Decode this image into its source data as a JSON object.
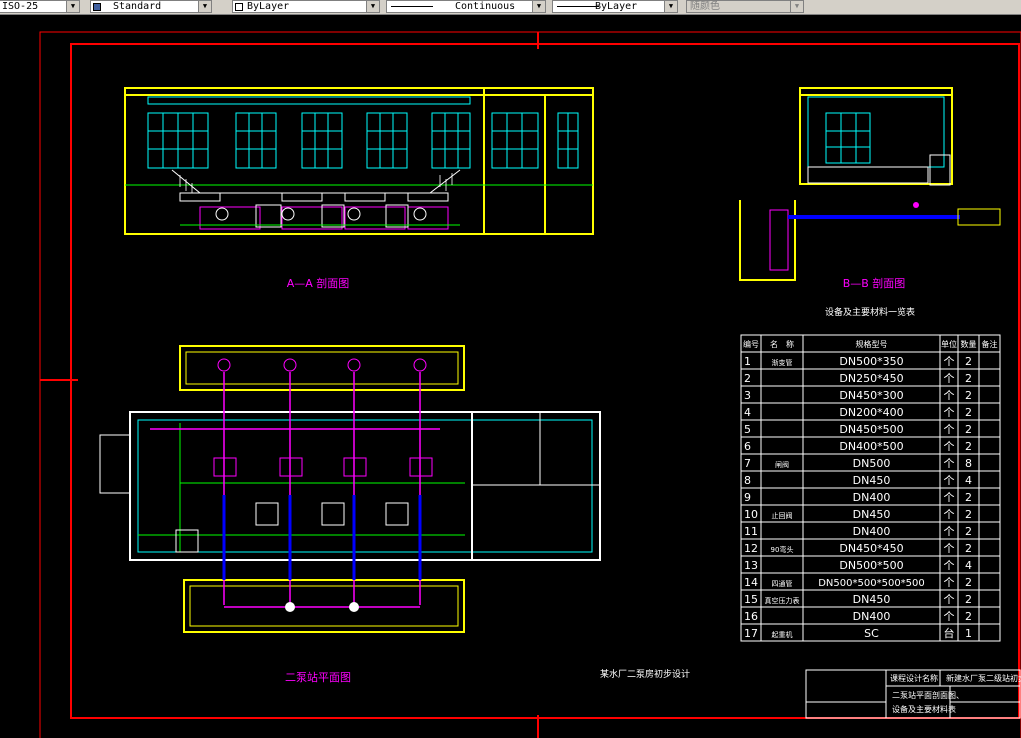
{
  "toolbar": {
    "dimstyle": "ISO-25",
    "textstyle": "Standard",
    "layer": "ByLayer",
    "linetype": "Continuous",
    "lineweight": "ByLayer",
    "plotstyle": "随颜色"
  },
  "drawing": {
    "section_a_title": "A—A 剖面图",
    "section_b_title": "B—B 剖面图",
    "plan_title": "二泵站平面图",
    "table_title": "设备及主要材料一览表",
    "table_headers": [
      "编号",
      "名　称",
      "规格型号",
      "单位",
      "数量",
      "备注"
    ],
    "table_rows": [
      [
        "1",
        "渐变管",
        "DN500*350",
        "个",
        "2",
        ""
      ],
      [
        "2",
        "",
        "DN250*450",
        "个",
        "2",
        ""
      ],
      [
        "3",
        "",
        "DN450*300",
        "个",
        "2",
        ""
      ],
      [
        "4",
        "",
        "DN200*400",
        "个",
        "2",
        ""
      ],
      [
        "5",
        "",
        "DN450*500",
        "个",
        "2",
        ""
      ],
      [
        "6",
        "",
        "DN400*500",
        "个",
        "2",
        ""
      ],
      [
        "7",
        "闸阀",
        "DN500",
        "个",
        "8",
        ""
      ],
      [
        "8",
        "",
        "DN450",
        "个",
        "4",
        ""
      ],
      [
        "9",
        "",
        "DN400",
        "个",
        "2",
        ""
      ],
      [
        "10",
        "止回阀",
        "DN450",
        "个",
        "2",
        ""
      ],
      [
        "11",
        "",
        "DN400",
        "个",
        "2",
        ""
      ],
      [
        "12",
        "90弯头",
        "DN450*450",
        "个",
        "2",
        ""
      ],
      [
        "13",
        "",
        "DN500*500",
        "个",
        "4",
        ""
      ],
      [
        "14",
        "四通管",
        "DN500*500*500*500",
        "个",
        "2",
        ""
      ],
      [
        "15",
        "真空压力表",
        "DN450",
        "个",
        "2",
        ""
      ],
      [
        "16",
        "",
        "DN400",
        "个",
        "2",
        ""
      ],
      [
        "17",
        "起重机",
        "SC",
        "台",
        "1",
        ""
      ]
    ],
    "note_label": "某水厂二泵房初步设计",
    "titleblock": {
      "project_label": "课程设计名称",
      "project_name": "新建水厂泵二级站初步设计",
      "drawing_name_1": "二泵站平面剖面图、",
      "drawing_name_2": "设备及主要材料表"
    }
  }
}
